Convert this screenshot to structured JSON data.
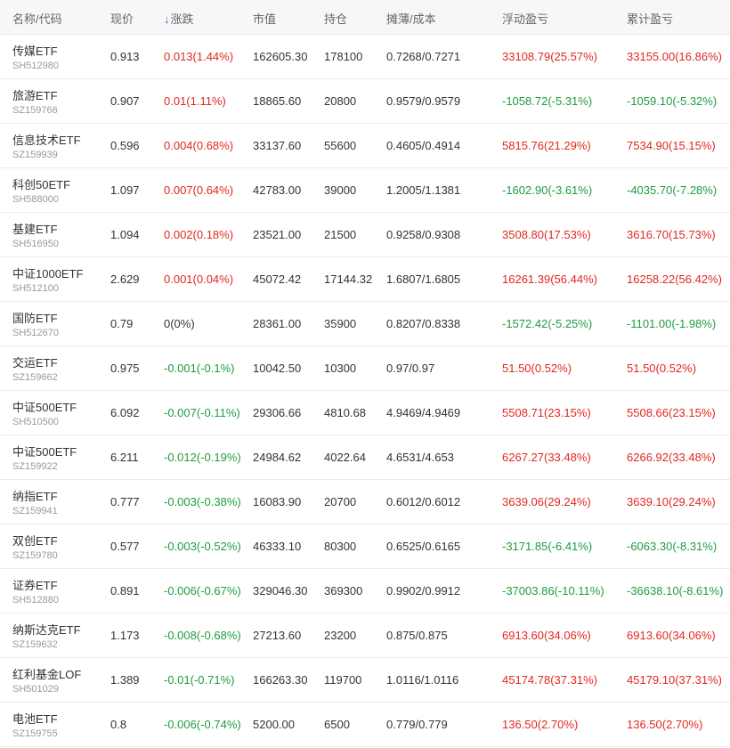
{
  "header": {
    "name": "名称/代码",
    "price": "现价",
    "sort_icon": "↓",
    "change": "涨跌",
    "market_value": "市值",
    "position": "持仓",
    "cost": "摊薄/成本",
    "float_pnl": "浮动盈亏",
    "total_pnl": "累计盈亏"
  },
  "colors": {
    "up": "#e0281f",
    "down": "#1f9c3f",
    "sort_arrow": "#3377dd"
  },
  "rows": [
    {
      "name": "传媒ETF",
      "code": "SH512980",
      "price": "0.913",
      "change": "0.013(1.44%)",
      "mv": "162605.30",
      "pos": "178100",
      "cost": "0.7268/0.7271",
      "float": "33108.79(25.57%)",
      "total": "33155.00(16.86%)",
      "cd": "up",
      "fd": "up",
      "td": "up"
    },
    {
      "name": "旅游ETF",
      "code": "SZ159766",
      "price": "0.907",
      "change": "0.01(1.11%)",
      "mv": "18865.60",
      "pos": "20800",
      "cost": "0.9579/0.9579",
      "float": "-1058.72(-5.31%)",
      "total": "-1059.10(-5.32%)",
      "cd": "up",
      "fd": "down",
      "td": "down"
    },
    {
      "name": "信息技术ETF",
      "code": "SZ159939",
      "price": "0.596",
      "change": "0.004(0.68%)",
      "mv": "33137.60",
      "pos": "55600",
      "cost": "0.4605/0.4914",
      "float": "5815.76(21.29%)",
      "total": "7534.90(15.15%)",
      "cd": "up",
      "fd": "up",
      "td": "up"
    },
    {
      "name": "科创50ETF",
      "code": "SH588000",
      "price": "1.097",
      "change": "0.007(0.64%)",
      "mv": "42783.00",
      "pos": "39000",
      "cost": "1.2005/1.1381",
      "float": "-1602.90(-3.61%)",
      "total": "-4035.70(-7.28%)",
      "cd": "up",
      "fd": "down",
      "td": "down"
    },
    {
      "name": "基建ETF",
      "code": "SH516950",
      "price": "1.094",
      "change": "0.002(0.18%)",
      "mv": "23521.00",
      "pos": "21500",
      "cost": "0.9258/0.9308",
      "float": "3508.80(17.53%)",
      "total": "3616.70(15.73%)",
      "cd": "up",
      "fd": "up",
      "td": "up"
    },
    {
      "name": "中证1000ETF",
      "code": "SH512100",
      "price": "2.629",
      "change": "0.001(0.04%)",
      "mv": "45072.42",
      "pos": "17144.32",
      "cost": "1.6807/1.6805",
      "float": "16261.39(56.44%)",
      "total": "16258.22(56.42%)",
      "cd": "up",
      "fd": "up",
      "td": "up"
    },
    {
      "name": "国防ETF",
      "code": "SH512670",
      "price": "0.79",
      "change": "0(0%)",
      "mv": "28361.00",
      "pos": "35900",
      "cost": "0.8207/0.8338",
      "float": "-1572.42(-5.25%)",
      "total": "-1101.00(-1.98%)",
      "cd": "flat",
      "fd": "down",
      "td": "down"
    },
    {
      "name": "交运ETF",
      "code": "SZ159662",
      "price": "0.975",
      "change": "-0.001(-0.1%)",
      "mv": "10042.50",
      "pos": "10300",
      "cost": "0.97/0.97",
      "float": "51.50(0.52%)",
      "total": "51.50(0.52%)",
      "cd": "down",
      "fd": "up",
      "td": "up"
    },
    {
      "name": "中证500ETF",
      "code": "SH510500",
      "price": "6.092",
      "change": "-0.007(-0.11%)",
      "mv": "29306.66",
      "pos": "4810.68",
      "cost": "4.9469/4.9469",
      "float": "5508.71(23.15%)",
      "total": "5508.66(23.15%)",
      "cd": "down",
      "fd": "up",
      "td": "up"
    },
    {
      "name": "中证500ETF",
      "code": "SZ159922",
      "price": "6.211",
      "change": "-0.012(-0.19%)",
      "mv": "24984.62",
      "pos": "4022.64",
      "cost": "4.6531/4.653",
      "float": "6267.27(33.48%)",
      "total": "6266.92(33.48%)",
      "cd": "down",
      "fd": "up",
      "td": "up"
    },
    {
      "name": "纳指ETF",
      "code": "SZ159941",
      "price": "0.777",
      "change": "-0.003(-0.38%)",
      "mv": "16083.90",
      "pos": "20700",
      "cost": "0.6012/0.6012",
      "float": "3639.06(29.24%)",
      "total": "3639.10(29.24%)",
      "cd": "down",
      "fd": "up",
      "td": "up"
    },
    {
      "name": "双创ETF",
      "code": "SZ159780",
      "price": "0.577",
      "change": "-0.003(-0.52%)",
      "mv": "46333.10",
      "pos": "80300",
      "cost": "0.6525/0.6165",
      "float": "-3171.85(-6.41%)",
      "total": "-6063.30(-8.31%)",
      "cd": "down",
      "fd": "down",
      "td": "down"
    },
    {
      "name": "证券ETF",
      "code": "SH512880",
      "price": "0.891",
      "change": "-0.006(-0.67%)",
      "mv": "329046.30",
      "pos": "369300",
      "cost": "0.9902/0.9912",
      "float": "-37003.86(-10.11%)",
      "total": "-36638.10(-8.61%)",
      "cd": "down",
      "fd": "down",
      "td": "down"
    },
    {
      "name": "纳斯达克ETF",
      "code": "SZ159632",
      "price": "1.173",
      "change": "-0.008(-0.68%)",
      "mv": "27213.60",
      "pos": "23200",
      "cost": "0.875/0.875",
      "float": "6913.60(34.06%)",
      "total": "6913.60(34.06%)",
      "cd": "down",
      "fd": "up",
      "td": "up"
    },
    {
      "name": "红利基金LOF",
      "code": "SH501029",
      "price": "1.389",
      "change": "-0.01(-0.71%)",
      "mv": "166263.30",
      "pos": "119700",
      "cost": "1.0116/1.0116",
      "float": "45174.78(37.31%)",
      "total": "45179.10(37.31%)",
      "cd": "down",
      "fd": "up",
      "td": "up"
    },
    {
      "name": "电池ETF",
      "code": "SZ159755",
      "price": "0.8",
      "change": "-0.006(-0.74%)",
      "mv": "5200.00",
      "pos": "6500",
      "cost": "0.779/0.779",
      "float": "136.50(2.70%)",
      "total": "136.50(2.70%)",
      "cd": "down",
      "fd": "up",
      "td": "up"
    }
  ]
}
